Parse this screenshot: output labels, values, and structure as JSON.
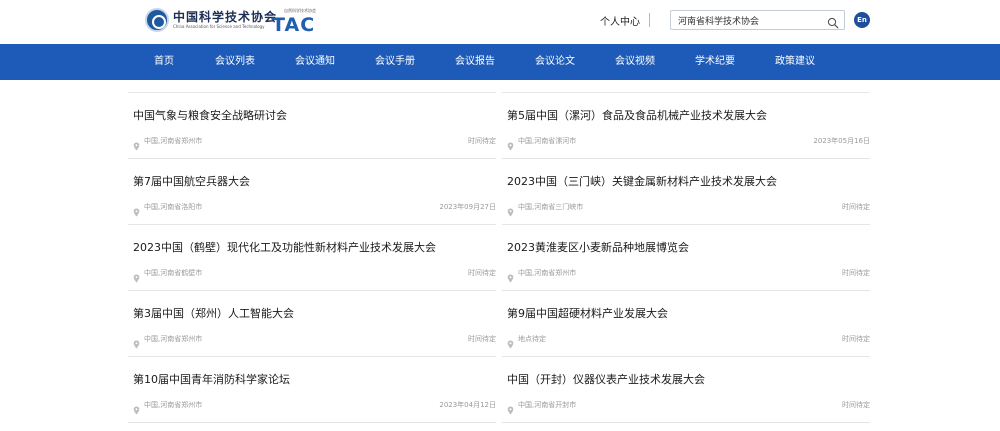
{
  "header": {
    "cast_logo_cn": "中国科学技术协会",
    "cast_logo_en": "China Association for Science and Technology",
    "tac_logo_sub": "自然科学技术协会",
    "tac_logo_text": "TAC",
    "personal_center": "个人中心",
    "search_value": "河南省科学技术协会",
    "lang_label": "En"
  },
  "nav": {
    "items": [
      {
        "label": "首页"
      },
      {
        "label": "会议列表"
      },
      {
        "label": "会议通知"
      },
      {
        "label": "会议手册"
      },
      {
        "label": "会议报告"
      },
      {
        "label": "会议论文"
      },
      {
        "label": "会议视频"
      },
      {
        "label": "学术纪要"
      },
      {
        "label": "政策建议"
      }
    ]
  },
  "conferences": [
    {
      "title": "中国气象与粮食安全战略研讨会",
      "location": "中国,河南省郑州市",
      "time": "时间待定"
    },
    {
      "title": "第5届中国（漯河）食品及食品机械产业技术发展大会",
      "location": "中国,河南省漯河市",
      "time": "2023年05月16日"
    },
    {
      "title": "第7届中国航空兵器大会",
      "location": "中国,河南省洛阳市",
      "time": "2023年09月27日"
    },
    {
      "title": "2023中国（三门峡）关键金属新材料产业技术发展大会",
      "location": "中国,河南省三门峡市",
      "time": "时间待定"
    },
    {
      "title": "2023中国（鹤壁）现代化工及功能性新材料产业技术发展大会",
      "location": "中国,河南省鹤壁市",
      "time": "时间待定"
    },
    {
      "title": "2023黄淮麦区小麦新品种地展博览会",
      "location": "中国,河南省郑州市",
      "time": "时间待定"
    },
    {
      "title": "第3届中国（郑州）人工智能大会",
      "location": "中国,河南省郑州市",
      "time": "时间待定"
    },
    {
      "title": "第9届中国超硬材料产业发展大会",
      "location": "地点待定",
      "time": "时间待定"
    },
    {
      "title": "第10届中国青年消防科学家论坛",
      "location": "中国,河南省郑州市",
      "time": "2023年04月12日"
    },
    {
      "title": "中国（开封）仪器仪表产业技术发展大会",
      "location": "中国,河南省开封市",
      "time": "时间待定"
    }
  ],
  "colors": {
    "nav_bg": "#1e5bb8",
    "lang_badge": "#1f4f9c",
    "meta_text": "#9a9a9a"
  },
  "icons": {
    "search": "search-icon",
    "location": "pin-icon"
  }
}
